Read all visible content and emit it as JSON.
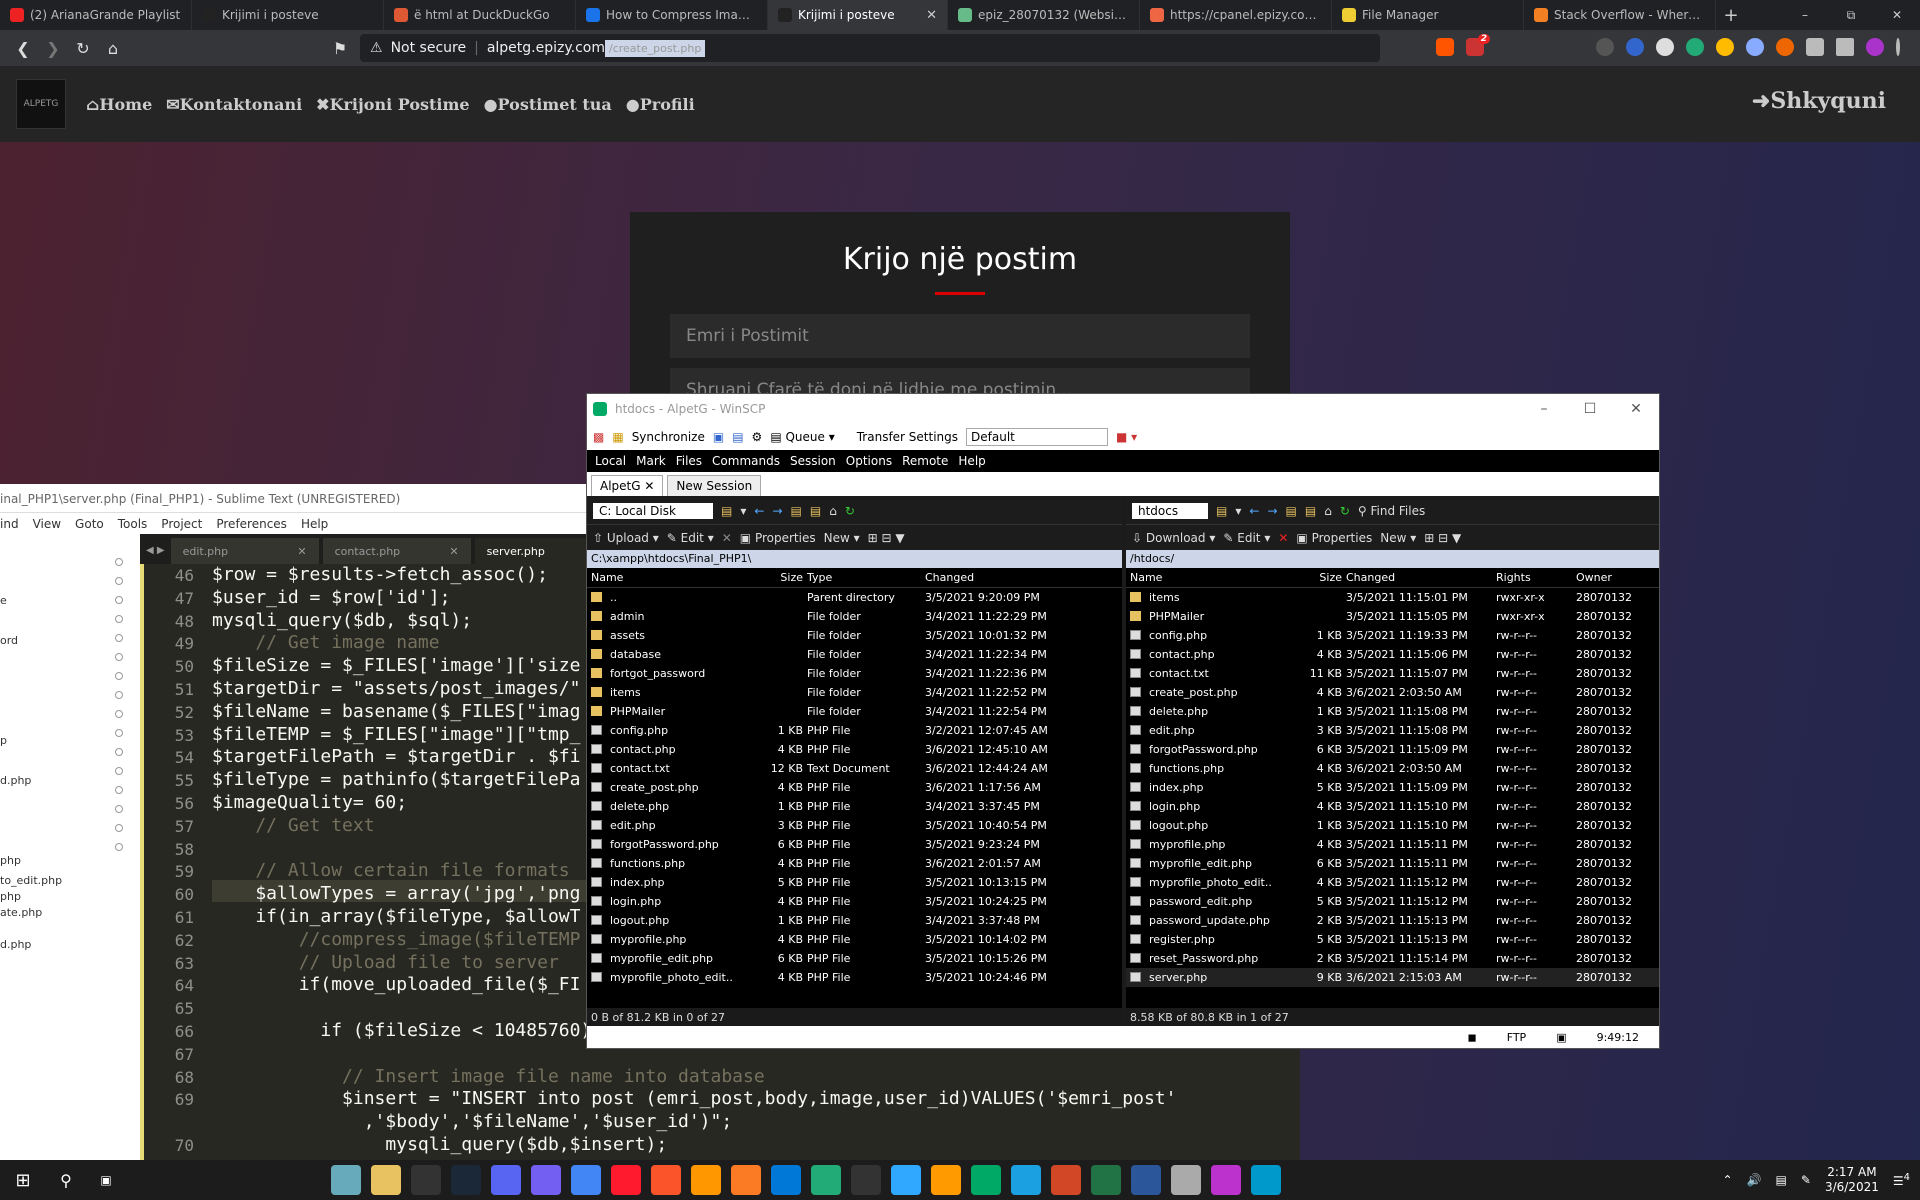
{
  "browser": {
    "tabs": [
      {
        "title": "(2) ArianaGrande Playlist",
        "color": "#e22"
      },
      {
        "title": "Krijimi i posteve",
        "color": "#222"
      },
      {
        "title": "ë html at DuckDuckGo",
        "color": "#de5833"
      },
      {
        "title": "How to Compress Image size",
        "color": "#1a73e8"
      },
      {
        "title": "Krijimi i posteve",
        "color": "#222",
        "active": true
      },
      {
        "title": "epiz_28070132 (Website for",
        "color": "#6b8"
      },
      {
        "title": "https://cpanel.epizy.com/pa",
        "color": "#e64"
      },
      {
        "title": "File Manager",
        "color": "#ec3"
      },
      {
        "title": "Stack Overflow - Where Dev",
        "color": "#f48024"
      }
    ],
    "url_warning": "Not secure",
    "url_host": "alpetg.epizy.com",
    "url_path": "/create_post.php",
    "ext_badge": "2"
  },
  "site": {
    "logo_text": "ALPETG",
    "nav": [
      "Home",
      "Kontaktonani",
      "Krijoni Postime",
      "Postimet tua",
      "Profili"
    ],
    "logout": "Shkyquni",
    "form_title": "Krijo një postim",
    "title_placeholder": "Emri i Postimit",
    "body_placeholder": "Shruani Çfarë të doni në lidhje me postimin..."
  },
  "sublime": {
    "title": "inal_PHP1\\server.php (Final_PHP1) - Sublime Text (UNREGISTERED)",
    "menu": [
      "ind",
      "View",
      "Goto",
      "Tools",
      "Project",
      "Preferences",
      "Help"
    ],
    "tabs": [
      "edit.php",
      "contact.php",
      "server.php"
    ],
    "sidebar": [
      "e",
      "ord",
      "p",
      "d.php",
      "php",
      "to_edit.php",
      "php",
      "ate.php",
      "d.php"
    ],
    "line_numbers": [
      "46",
      "47",
      "48",
      "49",
      "50",
      "51",
      "52",
      "53",
      "54",
      "55",
      "56",
      "57",
      "58",
      "59",
      "60",
      "61",
      "62",
      "63",
      "64",
      "65",
      "66",
      "67",
      "68",
      "69",
      "",
      "70"
    ],
    "code": [
      "$row = $results->fetch_assoc();",
      "$user_id = $row['id'];",
      "mysqli_query($db, $sql);",
      "    // Get image name",
      "$fileSize = $_FILES['image']['size",
      "$targetDir = \"assets/post_images/\"",
      "$fileName = basename($_FILES[\"imag",
      "$fileTEMP = $_FILES[\"image\"][\"tmp_",
      "$targetFilePath = $targetDir . $fi",
      "$fileType = pathinfo($targetFilePa",
      "$imageQuality= 60;",
      "    // Get text",
      "",
      "    // Allow certain file formats",
      "    $allowTypes = array('jpg','png",
      "    if(in_array($fileType, $allowT",
      "        //compress_image($fileTEMP",
      "        // Upload file to server",
      "        if(move_uploaded_file($_FI",
      "",
      "          if ($fileSize < 10485760) {",
      "",
      "            // Insert image file name into database",
      "            $insert = \"INSERT into post (emri_post,body,image,user_id)VALUES('$emri_post'",
      "              ,'$body','$fileName','$user_id')\";",
      "                mysqli_query($db,$insert);"
    ]
  },
  "winscp": {
    "title": "htdocs - AlpetG - WinSCP",
    "synchronize": "Synchronize",
    "queue": "Queue",
    "transfer_label": "Transfer Settings",
    "transfer_value": "Default",
    "menu": [
      "Local",
      "Mark",
      "Files",
      "Commands",
      "Session",
      "Options",
      "Remote",
      "Help"
    ],
    "session_tab": "AlpetG",
    "new_session": "New Session",
    "left": {
      "drive": "C: Local Disk",
      "buttons": [
        "Upload",
        "Edit",
        "Properties",
        "New"
      ],
      "path": "C:\\xampp\\htdocs\\Final_PHP1\\",
      "headers": [
        "Name",
        "Size",
        "Type",
        "Changed"
      ],
      "rows": [
        [
          "..",
          "",
          "Parent directory",
          "3/5/2021 9:20:09 PM",
          "up"
        ],
        [
          "admin",
          "",
          "File folder",
          "3/4/2021 11:22:29 PM",
          "folder"
        ],
        [
          "assets",
          "",
          "File folder",
          "3/5/2021 10:01:32 PM",
          "folder"
        ],
        [
          "database",
          "",
          "File folder",
          "3/4/2021 11:22:34 PM",
          "folder"
        ],
        [
          "fortgot_password",
          "",
          "File folder",
          "3/4/2021 11:22:36 PM",
          "folder"
        ],
        [
          "items",
          "",
          "File folder",
          "3/4/2021 11:22:52 PM",
          "folder"
        ],
        [
          "PHPMailer",
          "",
          "File folder",
          "3/4/2021 11:22:54 PM",
          "folder"
        ],
        [
          "config.php",
          "1 KB",
          "PHP File",
          "3/2/2021 12:07:45 AM",
          "file"
        ],
        [
          "contact.php",
          "4 KB",
          "PHP File",
          "3/6/2021 12:45:10 AM",
          "file"
        ],
        [
          "contact.txt",
          "12 KB",
          "Text Document",
          "3/6/2021 12:44:24 AM",
          "file"
        ],
        [
          "create_post.php",
          "4 KB",
          "PHP File",
          "3/6/2021 1:17:56 AM",
          "file"
        ],
        [
          "delete.php",
          "1 KB",
          "PHP File",
          "3/4/2021 3:37:45 PM",
          "file"
        ],
        [
          "edit.php",
          "3 KB",
          "PHP File",
          "3/5/2021 10:40:54 PM",
          "file"
        ],
        [
          "forgotPassword.php",
          "6 KB",
          "PHP File",
          "3/5/2021 9:23:24 PM",
          "file"
        ],
        [
          "functions.php",
          "4 KB",
          "PHP File",
          "3/6/2021 2:01:57 AM",
          "file"
        ],
        [
          "index.php",
          "5 KB",
          "PHP File",
          "3/5/2021 10:13:15 PM",
          "file"
        ],
        [
          "login.php",
          "4 KB",
          "PHP File",
          "3/5/2021 10:24:25 PM",
          "file"
        ],
        [
          "logout.php",
          "1 KB",
          "PHP File",
          "3/4/2021 3:37:48 PM",
          "file"
        ],
        [
          "myprofile.php",
          "4 KB",
          "PHP File",
          "3/5/2021 10:14:02 PM",
          "file"
        ],
        [
          "myprofile_edit.php",
          "6 KB",
          "PHP File",
          "3/5/2021 10:15:26 PM",
          "file"
        ],
        [
          "myprofile_photo_edit...",
          "4 KB",
          "PHP File",
          "3/5/2021 10:24:46 PM",
          "file"
        ]
      ],
      "status": "0 B of 81.2 KB in 0 of 27"
    },
    "right": {
      "drive": "htdocs",
      "buttons": [
        "Download",
        "Edit",
        "Properties",
        "New"
      ],
      "find": "Find Files",
      "path": "/htdocs/",
      "headers": [
        "Name",
        "Size",
        "Changed",
        "Rights",
        "Owner"
      ],
      "rows": [
        [
          "items",
          "",
          "3/5/2021 11:15:01 PM",
          "rwxr-xr-x",
          "28070132",
          "folder"
        ],
        [
          "PHPMailer",
          "",
          "3/5/2021 11:15:05 PM",
          "rwxr-xr-x",
          "28070132",
          "folder"
        ],
        [
          "config.php",
          "1 KB",
          "3/5/2021 11:19:33 PM",
          "rw-r--r--",
          "28070132",
          "file"
        ],
        [
          "contact.php",
          "4 KB",
          "3/5/2021 11:15:06 PM",
          "rw-r--r--",
          "28070132",
          "file"
        ],
        [
          "contact.txt",
          "11 KB",
          "3/5/2021 11:15:07 PM",
          "rw-r--r--",
          "28070132",
          "file"
        ],
        [
          "create_post.php",
          "4 KB",
          "3/6/2021 2:03:50 AM",
          "rw-r--r--",
          "28070132",
          "file"
        ],
        [
          "delete.php",
          "1 KB",
          "3/5/2021 11:15:08 PM",
          "rw-r--r--",
          "28070132",
          "file"
        ],
        [
          "edit.php",
          "3 KB",
          "3/5/2021 11:15:08 PM",
          "rw-r--r--",
          "28070132",
          "file"
        ],
        [
          "forgotPassword.php",
          "6 KB",
          "3/5/2021 11:15:09 PM",
          "rw-r--r--",
          "28070132",
          "file"
        ],
        [
          "functions.php",
          "4 KB",
          "3/6/2021 2:03:50 AM",
          "rw-r--r--",
          "28070132",
          "file"
        ],
        [
          "index.php",
          "5 KB",
          "3/5/2021 11:15:09 PM",
          "rw-r--r--",
          "28070132",
          "file"
        ],
        [
          "login.php",
          "4 KB",
          "3/5/2021 11:15:10 PM",
          "rw-r--r--",
          "28070132",
          "file"
        ],
        [
          "logout.php",
          "1 KB",
          "3/5/2021 11:15:10 PM",
          "rw-r--r--",
          "28070132",
          "file"
        ],
        [
          "myprofile.php",
          "4 KB",
          "3/5/2021 11:15:11 PM",
          "rw-r--r--",
          "28070132",
          "file"
        ],
        [
          "myprofile_edit.php",
          "6 KB",
          "3/5/2021 11:15:11 PM",
          "rw-r--r--",
          "28070132",
          "file"
        ],
        [
          "myprofile_photo_edit...",
          "4 KB",
          "3/5/2021 11:15:12 PM",
          "rw-r--r--",
          "28070132",
          "file"
        ],
        [
          "password_edit.php",
          "5 KB",
          "3/5/2021 11:15:12 PM",
          "rw-r--r--",
          "28070132",
          "file"
        ],
        [
          "password_update.php",
          "2 KB",
          "3/5/2021 11:15:13 PM",
          "rw-r--r--",
          "28070132",
          "file"
        ],
        [
          "register.php",
          "5 KB",
          "3/5/2021 11:15:13 PM",
          "rw-r--r--",
          "28070132",
          "file"
        ],
        [
          "reset_Password.php",
          "2 KB",
          "3/5/2021 11:15:14 PM",
          "rw-r--r--",
          "28070132",
          "file"
        ],
        [
          "server.php",
          "9 KB",
          "3/6/2021 2:15:03 AM",
          "rw-r--r--",
          "28070132",
          "file"
        ]
      ],
      "status": "8.58 KB of 80.8 KB in 1 of 27"
    },
    "protocol": "FTP",
    "timer": "9:49:12"
  },
  "taskbar": {
    "icons": [
      "file-explorer",
      "folder",
      "epic-games",
      "steam",
      "discord",
      "viber",
      "chrome",
      "opera",
      "brave",
      "sublime",
      "xampp",
      "vscode",
      "app",
      "terminal",
      "photoshop",
      "illustrator",
      "winscp-app",
      "winscp",
      "powerpoint",
      "excel",
      "word",
      "app2",
      "app3",
      "app4"
    ],
    "time": "2:17 AM",
    "date": "3/6/2021",
    "notif": "4"
  }
}
